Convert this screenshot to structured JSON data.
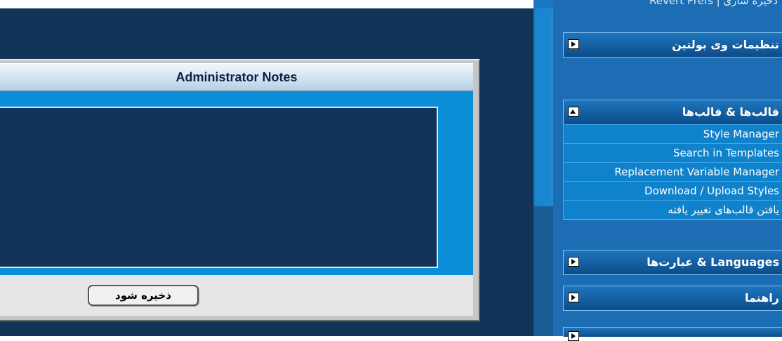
{
  "notes": {
    "title": "Administrator Notes",
    "textarea_value": "",
    "save_label": "ذخیره شود"
  },
  "nav": {
    "top_link": "Revert Prefs | ذخیره سازی",
    "groups": [
      {
        "label": "تنظیمات وی بولتین",
        "expanded": false
      },
      {
        "label": "قالب‌ها & قالب‌ها",
        "expanded": true,
        "items": [
          "Style Manager",
          "Search in Templates",
          "Replacement Variable Manager",
          "Download / Upload Styles",
          "یافتن قالب‌های تغییر یافته"
        ]
      },
      {
        "label": "Languages & عبارت‌ها",
        "expanded": false
      },
      {
        "label": "راهنما",
        "expanded": false
      }
    ]
  },
  "colors": {
    "navy": "#123458",
    "cyan": "#0b8fd8",
    "panel_gray": "#c6c6c6"
  }
}
